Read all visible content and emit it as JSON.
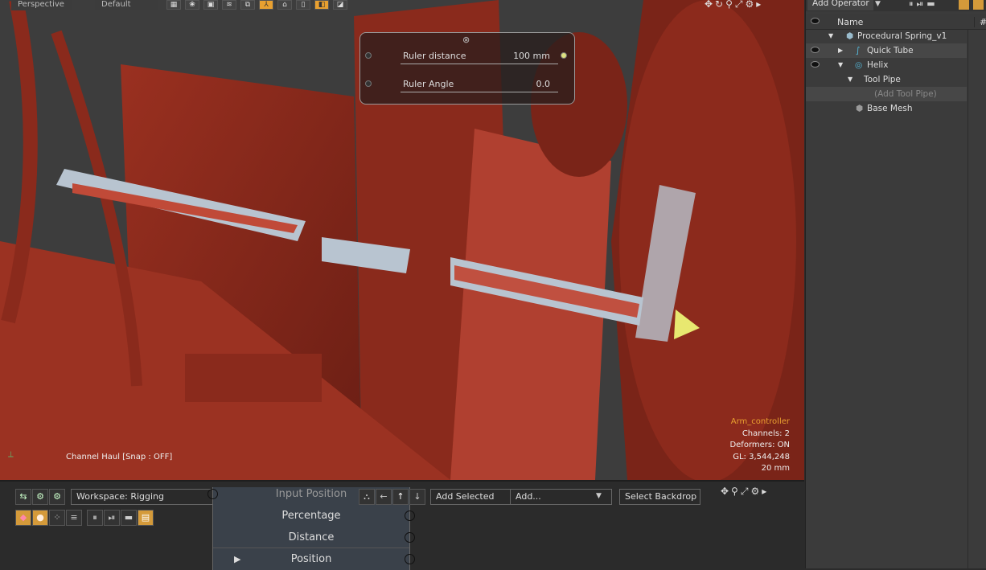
{
  "viewport": {
    "view_mode": "Perspective",
    "shading": "Default",
    "toolbar_icons": [
      "checker-icon",
      "pattern-icon",
      "frame-icon",
      "wave-icon",
      "copy-icon",
      "axis-icon",
      "mesh-icon",
      "item-icon",
      "layers-icon",
      "shade-icon"
    ],
    "hud": {
      "ruler_distance_label": "Ruler distance",
      "ruler_distance_value": "100 mm",
      "ruler_angle_label": "Ruler Angle",
      "ruler_angle_value": "0.0"
    },
    "info": {
      "item": "Arm_controller",
      "channels": "Channels: 2",
      "deformers": "Deformers: ON",
      "gl": "GL: 3,544,248",
      "scale": "20 mm"
    },
    "channel_haul": "Channel Haul  [Snap : OFF]"
  },
  "right_panel": {
    "add_operator": "Add Operator",
    "column_name": "Name",
    "column_hash": "#",
    "items": [
      {
        "label": "Procedural Spring_v1"
      },
      {
        "label": "Quick Tube"
      },
      {
        "label": "Helix"
      },
      {
        "label": "Tool Pipe"
      },
      {
        "label": "(Add Tool Pipe)"
      },
      {
        "label": "Base Mesh"
      }
    ]
  },
  "bottom": {
    "workspace": "Workspace: Rigging",
    "node_title": "Input Position",
    "node_rows": [
      "Percentage",
      "Distance",
      "Position"
    ],
    "add_selected": "Add Selected",
    "add": "Add...",
    "select_backdrop": "Select Backdrop"
  },
  "colors": {
    "accent": "#e8a030",
    "mesh": "#b03a28",
    "ruler": "#b8c4d0"
  }
}
